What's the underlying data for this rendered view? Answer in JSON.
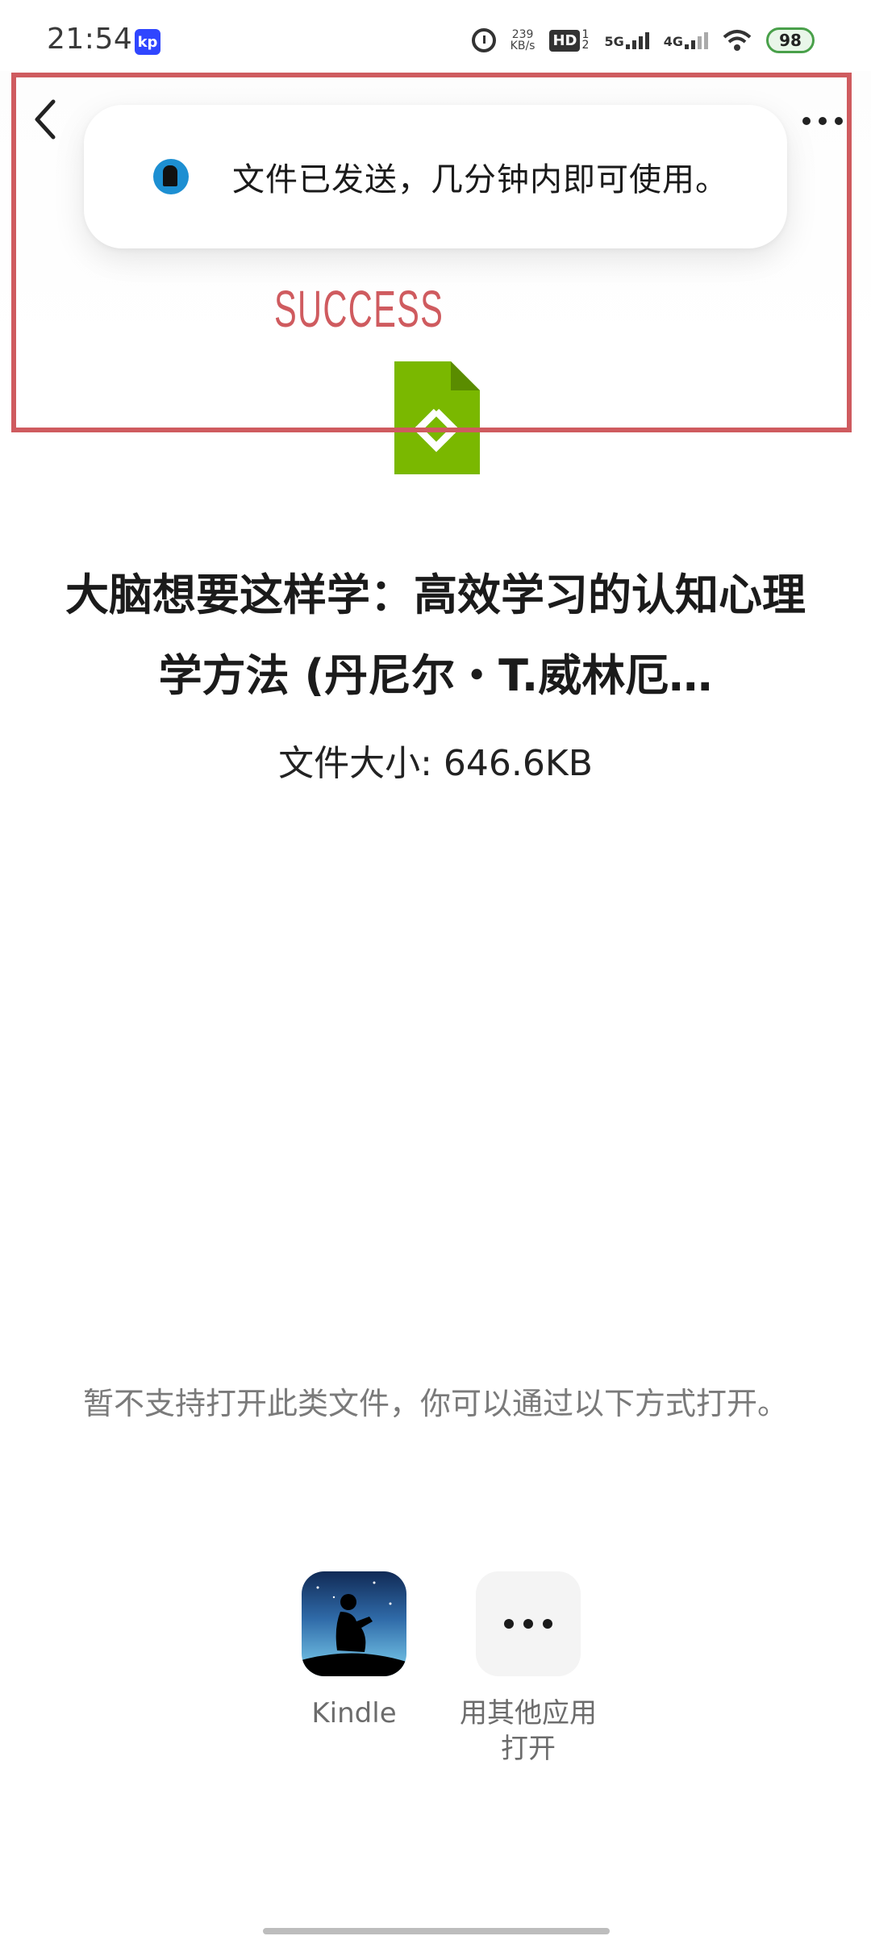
{
  "status_bar": {
    "time": "21:54",
    "app_badge": "kp",
    "network_speed_value": "239",
    "network_speed_unit": "KB/s",
    "hd_label": "HD",
    "hd_sub": "1 2",
    "net_5g": "5G",
    "net_4g": "4G",
    "battery": "98",
    "icons": [
      "alarm-icon",
      "signal-icon",
      "wifi-icon",
      "battery-icon"
    ]
  },
  "header": {
    "back_icon": "chevron-left-icon",
    "more_icon": "more-horizontal-icon"
  },
  "toast": {
    "icon": "kindle-icon",
    "text": "文件已发送，几分钟内即可使用。"
  },
  "annotation": {
    "label": "SUCCESS",
    "color": "#cf5b5f"
  },
  "file": {
    "icon": "epub-file-icon",
    "icon_color": "#7ab800",
    "title": "大脑想要这样学：高效学习的认知心理学方法 (丹尼尔・T.威林厄…",
    "size_label": "文件大小: 646.6KB"
  },
  "hint": "暂不支持打开此类文件，你可以通过以下方式打开。",
  "apps": [
    {
      "label": "Kindle",
      "icon": "kindle-app-icon"
    },
    {
      "label": "用其他应用打开",
      "icon": "more-icon"
    }
  ]
}
